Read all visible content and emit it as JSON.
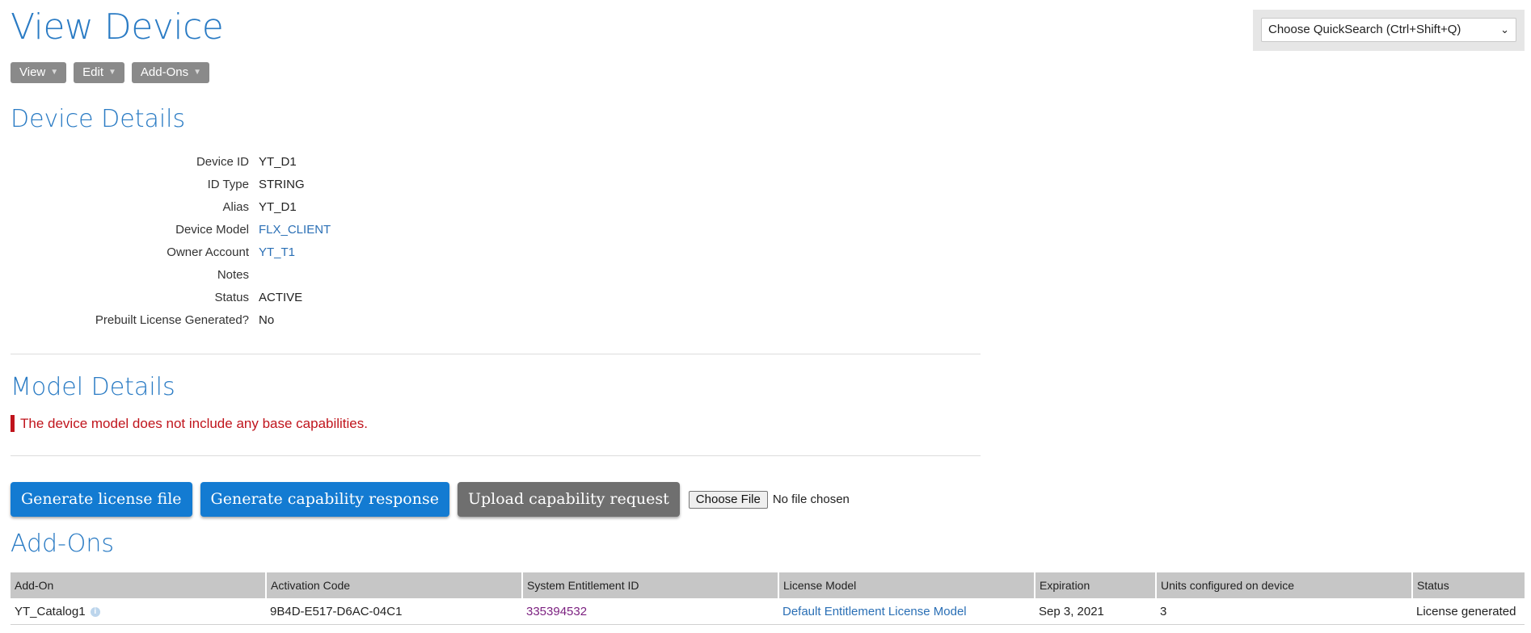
{
  "page": {
    "title": "View Device"
  },
  "quicksearch": {
    "selected": "Choose QuickSearch (Ctrl+Shift+Q)"
  },
  "menu": {
    "view": "View",
    "edit": "Edit",
    "addons": "Add-Ons"
  },
  "device_details": {
    "heading": "Device Details",
    "rows": [
      {
        "label": "Device ID",
        "value": "YT_D1"
      },
      {
        "label": "ID Type",
        "value": "STRING"
      },
      {
        "label": "Alias",
        "value": "YT_D1"
      },
      {
        "label": "Device Model",
        "value": "FLX_CLIENT"
      },
      {
        "label": "Owner Account",
        "value": "YT_T1"
      },
      {
        "label": "Notes",
        "value": ""
      },
      {
        "label": "Status",
        "value": "ACTIVE"
      },
      {
        "label": "Prebuilt License Generated?",
        "value": "No"
      }
    ]
  },
  "model_details": {
    "heading": "Model Details",
    "notice": "The device model does not include any base capabilities."
  },
  "actions": {
    "generate_license": "Generate license file",
    "generate_capability": "Generate capability response",
    "upload_capability": "Upload capability request",
    "choose_file": "Choose File",
    "no_file": "No file chosen"
  },
  "addons": {
    "heading": "Add-Ons",
    "columns": [
      "Add-On",
      "Activation Code",
      "System Entitlement ID",
      "License Model",
      "Expiration",
      "Units configured on device",
      "Status"
    ],
    "rows": [
      {
        "addon": "YT_Catalog1",
        "activation_code": "9B4D-E517-D6AC-04C1",
        "entitlement_id": "335394532",
        "license_model": "Default Entitlement License Model",
        "expiration": "Sep 3, 2021",
        "units": "3",
        "status": "License generated"
      }
    ]
  },
  "colors": {
    "accent": "#2a7bc4",
    "primary_button": "#137bd2",
    "secondary_button": "#6f6f6f",
    "error": "#c0141c",
    "table_header": "#c6c6c6"
  },
  "icons": {
    "info": "info-icon",
    "dropdown": "chevron-down-icon",
    "menu_caret": "caret-down-icon"
  }
}
